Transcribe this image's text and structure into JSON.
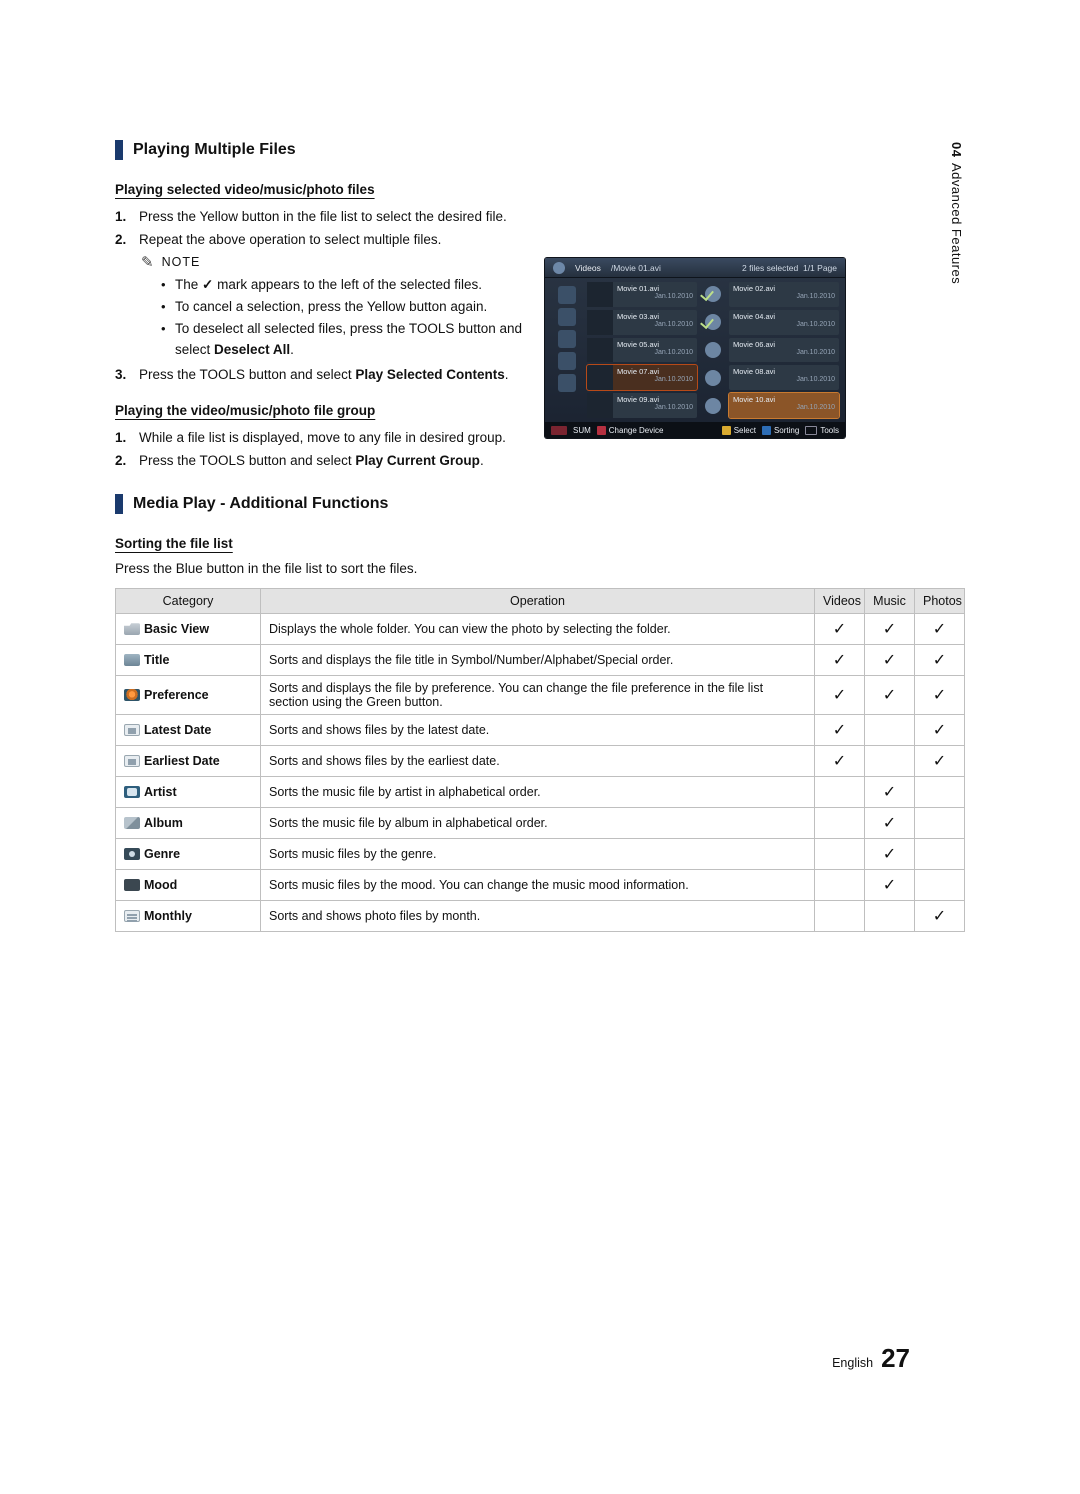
{
  "side": {
    "num": "04",
    "title": "Advanced Features"
  },
  "sections": {
    "s1": "Playing Multiple Files",
    "s2": "Media Play - Additional Functions"
  },
  "sel": {
    "h": "Playing selected video/music/photo files",
    "i1": "Press the Yellow button in the file list to select the desired file.",
    "i2": "Repeat the above operation to select multiple files.",
    "note": "NOTE",
    "b1a": "The ",
    "b1b": " mark appears to the left of the selected files.",
    "b2": "To cancel a selection, press the Yellow button again.",
    "b3a": "To deselect all selected files, press the ",
    "b3b": " button and select ",
    "b3c": ".",
    "tools": "TOOLS",
    "deselect": "Deselect All",
    "i3a": "Press the ",
    "i3b": " button and select ",
    "i3c": ".",
    "play_sel": "Play Selected Contents"
  },
  "grp": {
    "h": "Playing the video/music/photo file group",
    "i1": "While a file list is displayed, move to any file in desired group.",
    "i2a": "Press the ",
    "i2b": " button and select ",
    "i2c": ".",
    "play_grp": "Play Current Group"
  },
  "sort": {
    "h": "Sorting the file list",
    "desc": "Press the Blue button in the file list to sort the files.",
    "cols": {
      "cat": "Category",
      "op": "Operation",
      "v": "Videos",
      "m": "Music",
      "p": "Photos"
    },
    "rows": [
      {
        "ico": "ci-folder",
        "name": "Basic View",
        "op": "Displays the whole folder. You can view the photo by selecting the folder.",
        "v": true,
        "m": true,
        "p": true
      },
      {
        "ico": "ci-title",
        "name": "Title",
        "op": "Sorts and displays the file title in Symbol/Number/Alphabet/Special order.",
        "v": true,
        "m": true,
        "p": true
      },
      {
        "ico": "ci-pref",
        "name": "Preference",
        "op": "Sorts and displays the file by preference. You can change the file preference in the file list section using the Green button.",
        "v": true,
        "m": true,
        "p": true
      },
      {
        "ico": "ci-late",
        "name": "Latest Date",
        "op": "Sorts and shows files by the latest date.",
        "v": true,
        "m": false,
        "p": true
      },
      {
        "ico": "ci-early",
        "name": "Earliest Date",
        "op": "Sorts and shows files by the earliest date.",
        "v": true,
        "m": false,
        "p": true
      },
      {
        "ico": "ci-artist",
        "name": "Artist",
        "op": "Sorts the music file by artist in alphabetical order.",
        "v": false,
        "m": true,
        "p": false
      },
      {
        "ico": "ci-album",
        "name": "Album",
        "op": "Sorts the music file by album in alphabetical order.",
        "v": false,
        "m": true,
        "p": false
      },
      {
        "ico": "ci-genre",
        "name": "Genre",
        "op": "Sorts music files by the genre.",
        "v": false,
        "m": true,
        "p": false
      },
      {
        "ico": "ci-mood",
        "name": "Mood",
        "op": "Sorts music files by the mood. You can change the music mood information.",
        "v": false,
        "m": true,
        "p": false
      },
      {
        "ico": "ci-month",
        "name": "Monthly",
        "op": "Sorts and shows photo files by month.",
        "v": false,
        "m": false,
        "p": true
      }
    ]
  },
  "shot": {
    "title": "Videos",
    "path": "/Movie 01.avi",
    "status": "2 files selected",
    "page": "1/1 Page",
    "sum": "SUM",
    "change": "Change Device",
    "select": "Select",
    "sorting": "Sorting",
    "tools": "Tools",
    "date": "Jan.10.2010",
    "files": [
      "Movie 01.avi",
      "Movie 02.avi",
      "Movie 03.avi",
      "Movie 04.avi",
      "Movie 05.avi",
      "Movie 06.avi",
      "Movie 07.avi",
      "Movie 08.avi",
      "Movie 09.avi",
      "Movie 10.avi"
    ]
  },
  "footer": {
    "lang": "English",
    "page": "27"
  }
}
